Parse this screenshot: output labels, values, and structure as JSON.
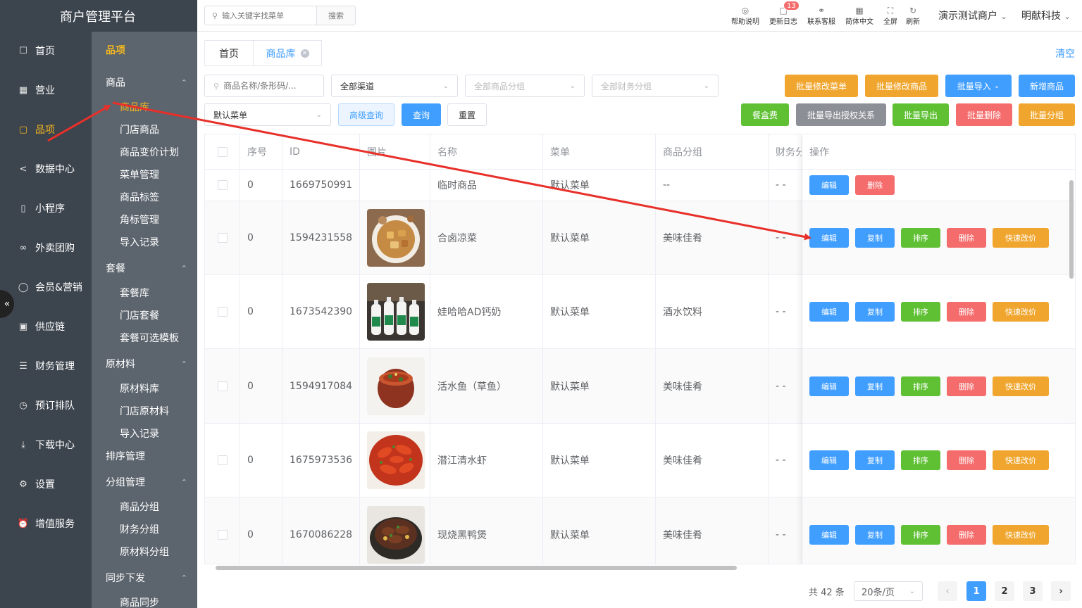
{
  "brand": "商户管理平台",
  "colors": {
    "accent": "#f5b820",
    "primary": "#409eff",
    "success": "#5fc034",
    "danger": "#f56c6c",
    "warning": "#f0a62e",
    "annotation": "#e8302a"
  },
  "nav": [
    {
      "label": "首页",
      "icon": "home-icon"
    },
    {
      "label": "营业",
      "icon": "calendar-icon"
    },
    {
      "label": "品项",
      "icon": "bag-icon"
    },
    {
      "label": "数据中心",
      "icon": "share-icon"
    },
    {
      "label": "小程序",
      "icon": "phone-icon"
    },
    {
      "label": "外卖团购",
      "icon": "bike-icon"
    },
    {
      "label": "会员&营销",
      "icon": "user-icon"
    },
    {
      "label": "供应链",
      "icon": "truck-icon"
    },
    {
      "label": "财务管理",
      "icon": "coins-icon"
    },
    {
      "label": "预订排队",
      "icon": "clock-icon"
    },
    {
      "label": "下载中心",
      "icon": "download-icon"
    },
    {
      "label": "设置",
      "icon": "gear-icon"
    },
    {
      "label": "增值服务",
      "icon": "alarm-icon"
    }
  ],
  "submenu": {
    "title": "品项",
    "groups": [
      {
        "label": "商品",
        "items": [
          "商品库",
          "门店商品",
          "商品变价计划",
          "菜单管理",
          "商品标签",
          "角标管理",
          "导入记录"
        ]
      },
      {
        "label": "套餐",
        "items": [
          "套餐库",
          "门店套餐",
          "套餐可选模板"
        ]
      },
      {
        "label": "原材料",
        "items": [
          "原材料库",
          "门店原材料",
          "导入记录"
        ]
      },
      {
        "label": "排序管理",
        "items": []
      },
      {
        "label": "分组管理",
        "items": [
          "商品分组",
          "财务分组",
          "原材料分组"
        ]
      },
      {
        "label": "同步下发",
        "items": [
          "商品同步"
        ]
      }
    ]
  },
  "header": {
    "search_placeholder": "输入关键字找菜单",
    "search_button": "搜索",
    "buttons": [
      {
        "label": "帮助说明",
        "icon": "help-icon"
      },
      {
        "label": "更新日志",
        "icon": "message-icon"
      },
      {
        "label": "联系客服",
        "icon": "headset-icon"
      },
      {
        "label": "简体中文",
        "icon": "language-icon"
      },
      {
        "label": "全屏",
        "icon": "fullscreen-icon"
      },
      {
        "label": "刷新",
        "icon": "refresh-icon"
      }
    ],
    "badge": "13",
    "merchant": "演示测试商户",
    "company": "明献科技"
  },
  "tabs": {
    "home": "首页",
    "current": "商品库",
    "clear": "清空"
  },
  "filters": {
    "keyword_placeholder": "商品名称/条形码/...",
    "channel": "全部渠道",
    "goods_group_placeholder": "全部商品分组",
    "finance_group_placeholder": "全部财务分组",
    "menu": "默认菜单",
    "advanced": "高级查询",
    "query": "查询",
    "reset": "重置"
  },
  "actions": {
    "row1": [
      "批量修改菜单",
      "批量修改商品",
      "批量导入",
      "新增商品"
    ],
    "row2": [
      "餐盒费",
      "批量导出授权关系",
      "批量导出",
      "批量删除",
      "批量分组"
    ]
  },
  "table": {
    "headers": [
      "序号",
      "ID",
      "图片",
      "名称",
      "菜单",
      "商品分组",
      "财务分",
      "操作"
    ],
    "rows": [
      {
        "seq": "0",
        "id": "1669750991",
        "image": "",
        "name": "临时商品",
        "menu": "默认菜单",
        "group": "--",
        "finance": "- -",
        "ops": [
          "编辑",
          "删除"
        ]
      },
      {
        "seq": "0",
        "id": "1594231558",
        "image": "food-braised",
        "name": "合卤凉菜",
        "menu": "默认菜单",
        "group": "美味佳肴",
        "finance": "- -",
        "ops": [
          "编辑",
          "复制",
          "排序",
          "删除",
          "快速改价"
        ]
      },
      {
        "seq": "0",
        "id": "1673542390",
        "image": "drink-bottles",
        "name": "娃哈哈AD钙奶",
        "menu": "默认菜单",
        "group": "酒水饮料",
        "finance": "- -",
        "ops": [
          "编辑",
          "复制",
          "排序",
          "删除",
          "快速改价"
        ]
      },
      {
        "seq": "0",
        "id": "1594917084",
        "image": "food-fish",
        "name": "活水鱼（草鱼）",
        "menu": "默认菜单",
        "group": "美味佳肴",
        "finance": "- -",
        "ops": [
          "编辑",
          "复制",
          "排序",
          "删除",
          "快速改价"
        ]
      },
      {
        "seq": "0",
        "id": "1675973536",
        "image": "food-crayfish",
        "name": "潜江清水虾",
        "menu": "默认菜单",
        "group": "美味佳肴",
        "finance": "- -",
        "ops": [
          "编辑",
          "复制",
          "排序",
          "删除",
          "快速改价"
        ]
      },
      {
        "seq": "0",
        "id": "1670086228",
        "image": "food-duck",
        "name": "现烧黑鸭煲",
        "menu": "默认菜单",
        "group": "美味佳肴",
        "finance": "- -",
        "ops": [
          "编辑",
          "复制",
          "排序",
          "删除",
          "快速改价"
        ]
      }
    ]
  },
  "pagination": {
    "total": "共 42 条",
    "page_size": "20条/页",
    "pages": [
      "1",
      "2",
      "3"
    ],
    "current": "1"
  }
}
